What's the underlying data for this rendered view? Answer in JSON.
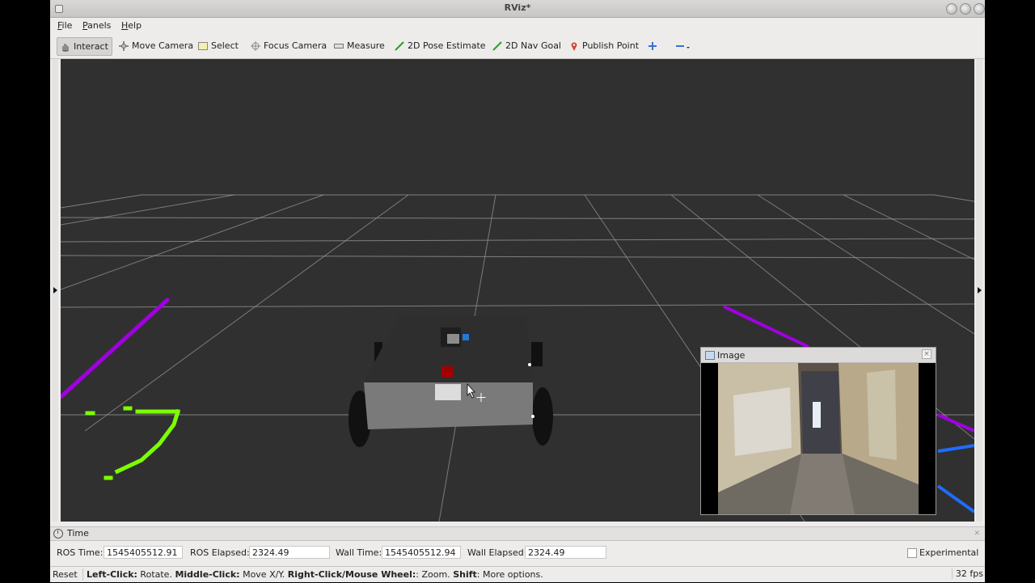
{
  "window": {
    "title": "RViz*"
  },
  "menubar": {
    "items": [
      {
        "label": "File",
        "accel": "F",
        "rest": "ile"
      },
      {
        "label": "Panels",
        "accel": "P",
        "rest": "anels"
      },
      {
        "label": "Help",
        "accel": "H",
        "rest": "elp"
      }
    ]
  },
  "toolbar": {
    "interact": "Interact",
    "move_camera": "Move Camera",
    "select": "Select",
    "focus_camera": "Focus Camera",
    "measure": "Measure",
    "pose_estimate": "2D Pose Estimate",
    "nav_goal": "2D Nav Goal",
    "publish_point": "Publish Point",
    "add_tool_icon": "plus-icon",
    "remove_tool_icon": "minus-dropdown-icon"
  },
  "image_panel": {
    "title": "Image"
  },
  "time_panel": {
    "title": "Time",
    "ros_time_label": "ROS Time:",
    "ros_time": "1545405512.91",
    "ros_elapsed_label": "ROS Elapsed:",
    "ros_elapsed": "2324.49",
    "wall_time_label": "Wall Time:",
    "wall_time": "1545405512.94",
    "wall_elapsed_label": "Wall Elapsed:",
    "wall_elapsed": "2324.49",
    "experimental_label": "Experimental",
    "experimental_checked": false
  },
  "statusbar": {
    "reset": "Reset",
    "left_click": "Left-Click:",
    "left_click_desc": " Rotate. ",
    "middle_click": "Middle-Click:",
    "middle_click_desc": " Move X/Y. ",
    "right_click": "Right-Click/Mouse Wheel:",
    "right_click_desc": ": Zoom. ",
    "shift": "Shift",
    "shift_desc": ": More options.",
    "fps": "32 fps"
  },
  "colors": {
    "viewport_bg": "#303030",
    "grid": "#a0a0a0",
    "laser_near": "#7cff00",
    "laser_far": "#b000e0",
    "laser_blue": "#1e6cff",
    "robot_body": "#7a7a7a"
  }
}
